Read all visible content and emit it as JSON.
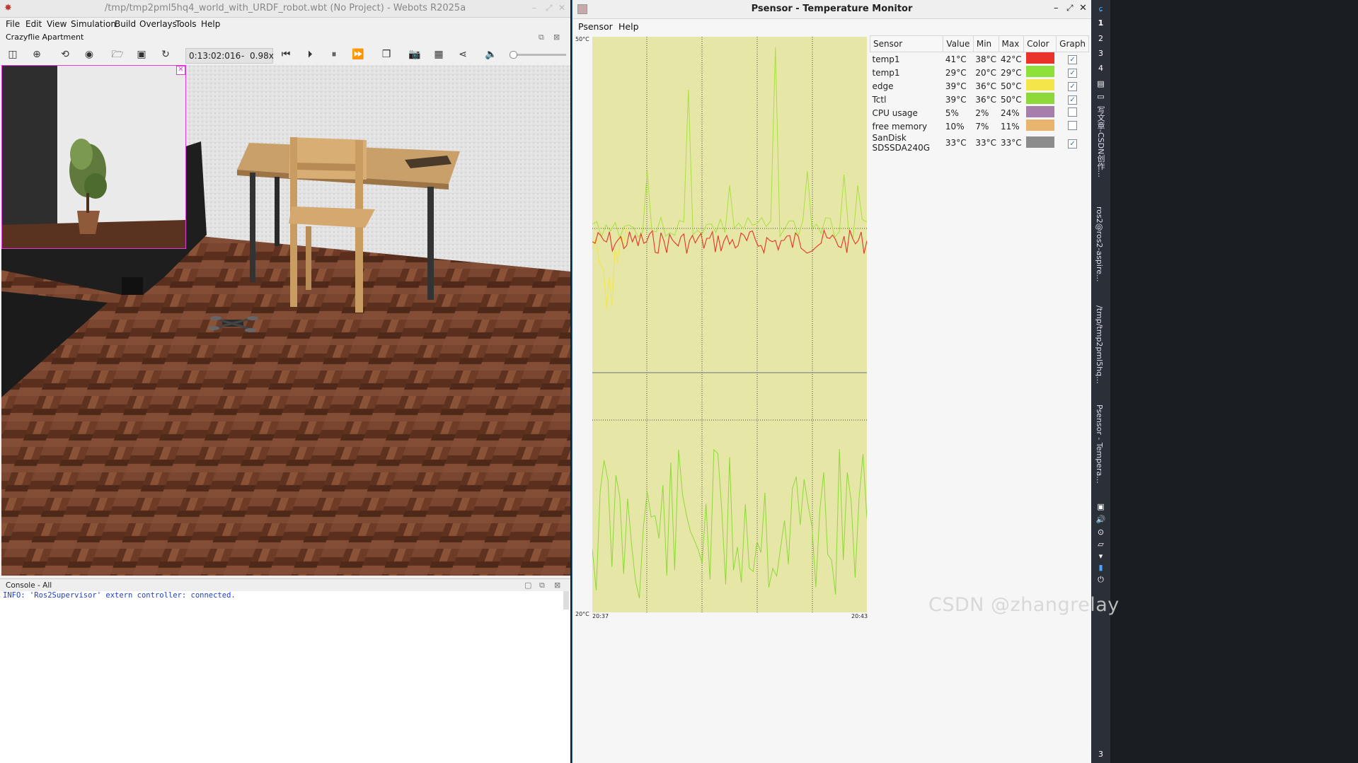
{
  "webots": {
    "title": "/tmp/tmp2pml5hq4_world_with_URDF_robot.wbt (No Project) - Webots R2025a",
    "menu": [
      "File",
      "Edit",
      "View",
      "Simulation",
      "Build",
      "Overlays",
      "Tools",
      "Help"
    ],
    "world_name": "Crazyflie Apartment",
    "time": "0:13:02:016",
    "speed_sep": "-",
    "speed": "0.98x",
    "console_title": "Console - All",
    "console_line": "INFO: 'Ros2Supervisor' extern controller: connected."
  },
  "psensor": {
    "title": "Psensor - Temperature Monitor",
    "menu": [
      "Psensor",
      "Help"
    ],
    "y_max": "50°C",
    "y_min": "20°C",
    "t_start": "20:37",
    "t_end": "20:43",
    "columns": [
      "Sensor",
      "Value",
      "Min",
      "Max",
      "Color",
      "Graph"
    ],
    "rows": [
      {
        "sensor": "temp1",
        "value": "41°C",
        "min": "38°C",
        "max": "42°C",
        "color": "#e8322a",
        "graph": true
      },
      {
        "sensor": "temp1",
        "value": "29°C",
        "min": "20°C",
        "max": "29°C",
        "color": "#8ee03a",
        "graph": true
      },
      {
        "sensor": "edge",
        "value": "39°C",
        "min": "36°C",
        "max": "50°C",
        "color": "#f4e54a",
        "graph": true
      },
      {
        "sensor": "Tctl",
        "value": "39°C",
        "min": "36°C",
        "max": "50°C",
        "color": "#8ed83a",
        "graph": true
      },
      {
        "sensor": "CPU usage",
        "value": "5%",
        "min": "2%",
        "max": "24%",
        "color": "#a57eac",
        "graph": false
      },
      {
        "sensor": "free memory",
        "value": "10%",
        "min": "7%",
        "max": "11%",
        "color": "#e9b56e",
        "graph": false
      },
      {
        "sensor": "SanDisk SDSSDA240G",
        "value": "33°C",
        "min": "33°C",
        "max": "33°C",
        "color": "#8c8c8c",
        "graph": true
      }
    ]
  },
  "panel": {
    "workspaces": [
      "1",
      "2",
      "3",
      "4"
    ],
    "tasks": [
      "写文章-CSDN创作...",
      "ros2@ros2-aspire...",
      "/tmp/tmp2pml5hq...",
      "Psensor - Tempera..."
    ],
    "clock": "3"
  },
  "watermark": "CSDN @zhangrelay"
}
